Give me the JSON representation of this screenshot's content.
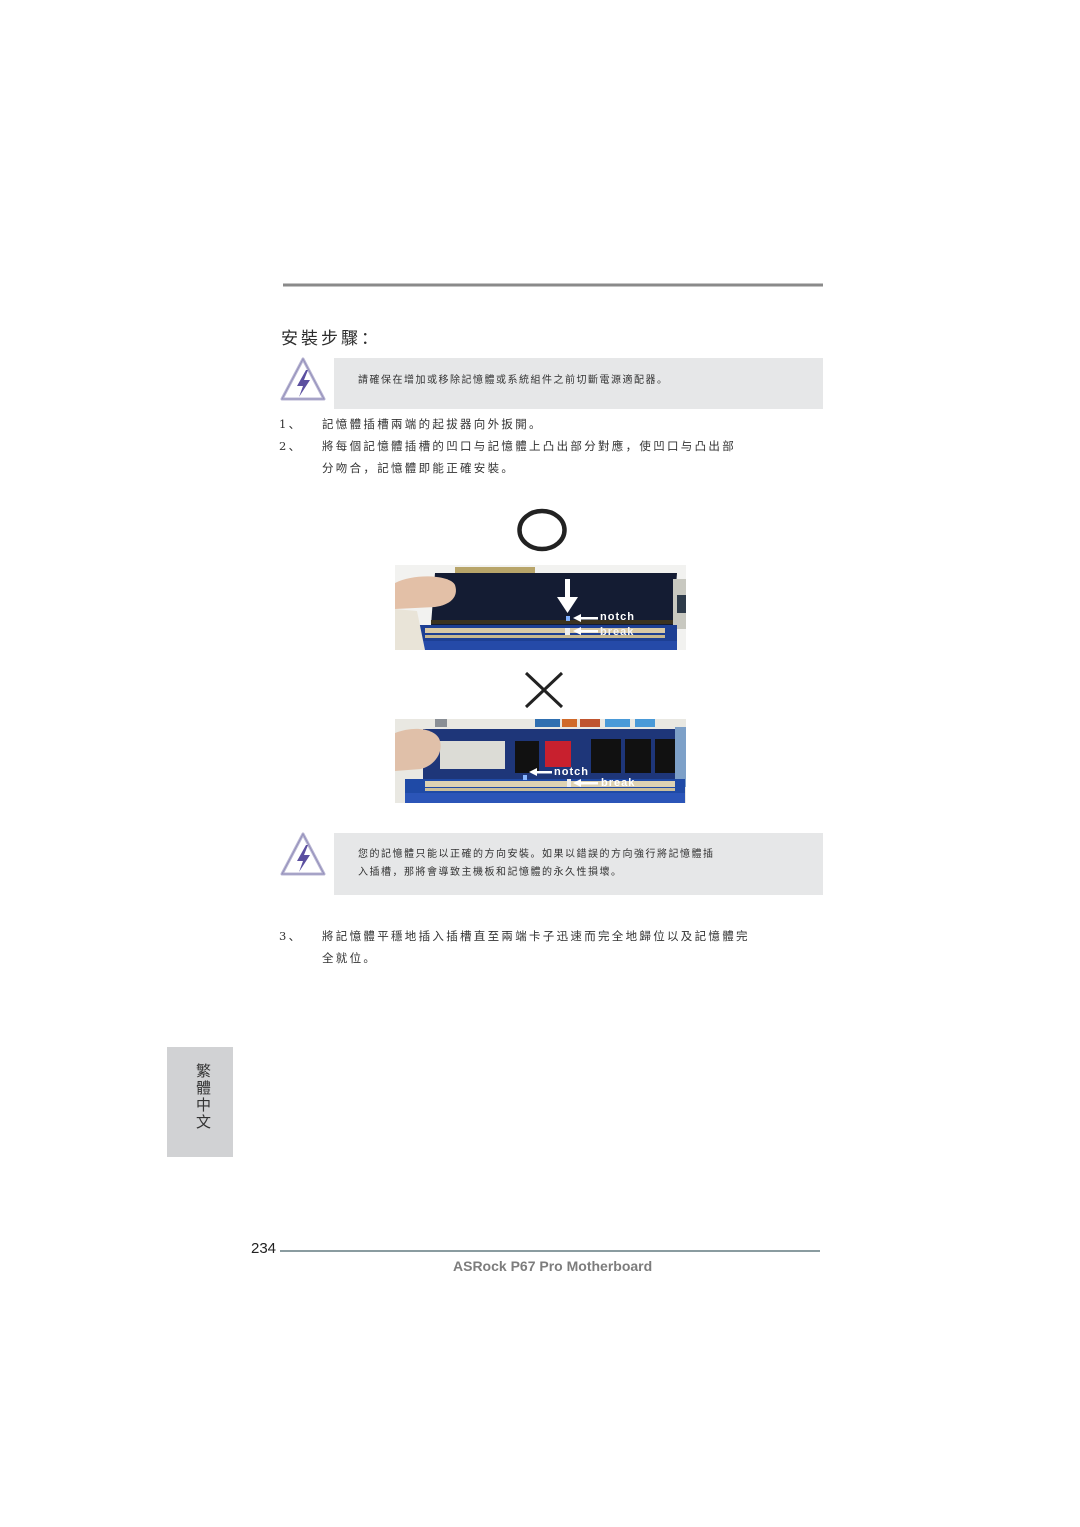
{
  "header": {
    "section_title": "安裝步驟："
  },
  "notes": [
    {
      "icon": "warning-lightning-icon",
      "text_lines": [
        "請確保在增加或移除記憶體或系統組件之前切斷電源適配器。"
      ]
    },
    {
      "icon": "warning-lightning-icon",
      "text_lines": [
        "您的記憶體只能以正確的方向安裝。如果以錯誤的方向強行將記憶體插",
        "入插槽，那將會導致主機板和記憶體的永久性損壞。"
      ]
    }
  ],
  "steps": [
    {
      "number": "1、",
      "lines": [
        "記憶體插槽兩端的起拔器向外扳開。"
      ]
    },
    {
      "number": "2、",
      "lines": [
        "將每個記憶體插槽的凹口与記憶體上凸出部分對應，使凹口与凸出部",
        "分吻合，記憶體即能正確安裝。"
      ]
    },
    {
      "number": "3、",
      "lines": [
        "將記憶體平穩地插入插槽直至兩端卡子迅速而完全地歸位以及記憶體完",
        "全就位。"
      ]
    }
  ],
  "figures": [
    {
      "mark": "correct-circle-icon",
      "labels": {
        "notch": "notch",
        "break": "break"
      }
    },
    {
      "mark": "incorrect-x-icon",
      "labels": {
        "notch": "notch",
        "break": "break"
      }
    }
  ],
  "side_tab": {
    "label": "繁體中文"
  },
  "footer": {
    "page_number": "234",
    "title": "ASRock  P67 Pro  Motherboard"
  },
  "colors": {
    "note_bg": "#e6e7e8",
    "side_tab_bg": "#d1d2d4",
    "warning_icon": "#5b4fa0",
    "rule": "#8a8a8a"
  }
}
